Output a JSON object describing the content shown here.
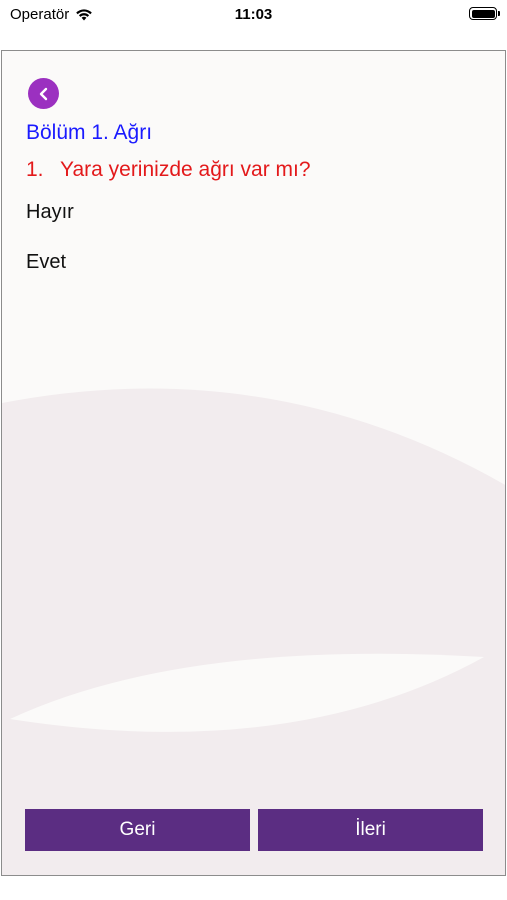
{
  "status_bar": {
    "carrier": "Operatör",
    "time": "11:03",
    "icons": [
      "wifi-icon",
      "battery-icon"
    ]
  },
  "header": {
    "back_icon": "chevron-left-icon",
    "section_title": "Bölüm 1. Ağrı"
  },
  "question": {
    "number": "1.",
    "text": "Yara yerinizde ağrı var mı?"
  },
  "options": [
    "Hayır",
    "Evet"
  ],
  "footer": {
    "back_label": "Geri",
    "next_label": "İleri"
  },
  "colors": {
    "section_title": "#1a1aff",
    "question": "#e3191b",
    "button": "#5b2d82",
    "back_circle": "#9b30c0",
    "panel_bg": "#fbfaf9",
    "wave": "#f2ecee"
  }
}
